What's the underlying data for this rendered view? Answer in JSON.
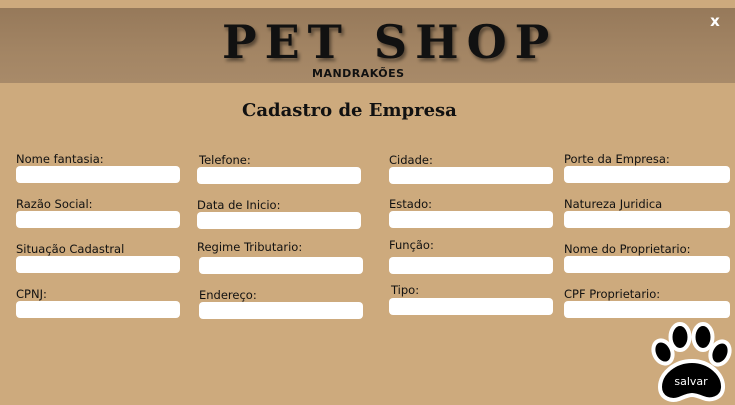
{
  "header": {
    "logo_title": "PET SHOP",
    "logo_subtitle": "MANDRAKÕES",
    "close_label": "x"
  },
  "form": {
    "title": "Cadastro de Empresa",
    "fields": {
      "nome_fantasia": {
        "label": "Nome fantasia:",
        "value": ""
      },
      "razao_social": {
        "label": "Razão Social:",
        "value": ""
      },
      "situacao_cadastral": {
        "label": "Situação Cadastral",
        "value": ""
      },
      "cpnj": {
        "label": "CPNJ:",
        "value": ""
      },
      "telefone": {
        "label": "Telefone:",
        "value": ""
      },
      "data_inicio": {
        "label": "Data de Inicio:",
        "value": ""
      },
      "regime_tributario": {
        "label": "Regime Tributario:",
        "value": ""
      },
      "endereco": {
        "label": "Endereço:",
        "value": ""
      },
      "cidade": {
        "label": "Cidade:",
        "value": ""
      },
      "estado": {
        "label": "Estado:",
        "value": ""
      },
      "funcao": {
        "label": "Função:",
        "value": ""
      },
      "tipo": {
        "label": "Tipo:",
        "value": ""
      },
      "porte_empresa": {
        "label": "Porte da Empresa:",
        "value": ""
      },
      "natureza_juridica": {
        "label": "Natureza Juridica",
        "value": ""
      },
      "nome_proprietario": {
        "label": "Nome do Proprietario:",
        "value": ""
      },
      "cpf_proprietario": {
        "label": "CPF Proprietario:",
        "value": ""
      }
    },
    "save_label": "salvar"
  },
  "colors": {
    "background": "#cdaa7d",
    "banner": "#a38564",
    "input": "#ffffff",
    "text": "#111111"
  },
  "icons": {
    "save": "paw-print-icon",
    "close": "close-icon"
  }
}
